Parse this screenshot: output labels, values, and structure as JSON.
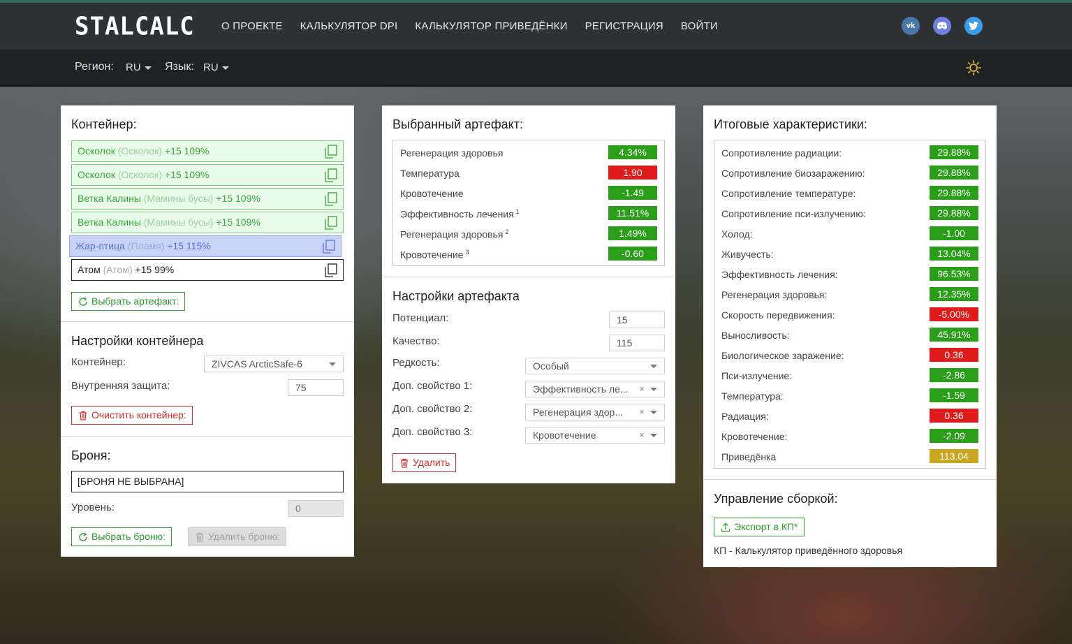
{
  "nav": {
    "logo": "STALCALC",
    "links": [
      "О ПРОЕКТЕ",
      "КАЛЬКУЛЯТОР DPI",
      "КАЛЬКУЛЯТОР ПРИВЕДЁНКИ",
      "РЕГИСТРАЦИЯ",
      "ВОЙТИ"
    ],
    "social": [
      "vk-icon",
      "discord-icon",
      "twitter-icon"
    ]
  },
  "subbar": {
    "region_label": "Регион:",
    "region_value": "RU",
    "lang_label": "Язык:",
    "lang_value": "RU"
  },
  "container_panel": {
    "title": "Контейнер:",
    "artifacts": [
      {
        "name": "Осколок",
        "sub": "(Осколок)",
        "level": "+15 109%"
      },
      {
        "name": "Осколок",
        "sub": "(Осколок)",
        "level": "+15 109%"
      },
      {
        "name": "Ветка Калины",
        "sub": "(Мамины бусы)",
        "level": "+15 109%"
      },
      {
        "name": "Ветка Калины",
        "sub": "(Мамины бусы)",
        "level": "+15 109%"
      },
      {
        "name": "Жар-птица",
        "sub": "(Пламя)",
        "level": "+15 115%"
      },
      {
        "name": "Атом",
        "sub": "(Атом)",
        "level": "+15 99%"
      }
    ],
    "select_button": "Выбрать артефакт:",
    "settings_title": "Настройки контейнера",
    "container_label": "Контейнер:",
    "container_value": "ZIVCAS ArcticSafe-6",
    "inner_protection_label": "Внутренняя защита:",
    "inner_protection_value": "75",
    "clear_button": "Очистить контейнер:",
    "armor_title": "Броня:",
    "armor_value": "[БРОНЯ НЕ ВЫБРАНА]",
    "level_label": "Уровень:",
    "level_value": "0",
    "select_armor_button": "Выбрать броню:",
    "delete_armor_button": "Удалить броню:"
  },
  "artifact_panel": {
    "title": "Выбранный артефакт:",
    "stats": [
      {
        "label": "Регенерация здоровья",
        "sup": "",
        "value": "4.34%",
        "color": "g"
      },
      {
        "label": "Температура",
        "sup": "",
        "value": "1.90",
        "color": "r"
      },
      {
        "label": "Кровотечение",
        "sup": "",
        "value": "-1.49",
        "color": "g"
      },
      {
        "label": "Эффективность лечения",
        "sup": "1",
        "value": "11.51%",
        "color": "g"
      },
      {
        "label": "Регенерация здоровья",
        "sup": "2",
        "value": "1.49%",
        "color": "g"
      },
      {
        "label": "Кровотечение",
        "sup": "3",
        "value": "-0.60",
        "color": "g"
      }
    ],
    "settings_title": "Настройки артефакта",
    "potential_label": "Потенциал:",
    "potential_value": "15",
    "quality_label": "Качество:",
    "quality_value": "115",
    "rarity_label": "Редкость:",
    "rarity_value": "Особый",
    "prop1_label": "Доп. свойство 1:",
    "prop1_value": "Эффективность ле...",
    "prop2_label": "Доп. свойство 2:",
    "prop2_value": "Регенерация здор...",
    "prop3_label": "Доп. свойство 3:",
    "prop3_value": "Кровотечение",
    "delete_button": "Удалить"
  },
  "result_panel": {
    "title": "Итоговые характеристики:",
    "stats": [
      {
        "label": "Сопротивление радиации:",
        "value": "29.88%",
        "color": "g"
      },
      {
        "label": "Сопротивление биозаражению:",
        "value": "29.88%",
        "color": "g"
      },
      {
        "label": "Сопротивление температуре:",
        "value": "29.88%",
        "color": "g"
      },
      {
        "label": "Сопротивление пси-излучению:",
        "value": "29.88%",
        "color": "g"
      },
      {
        "label": "Холод:",
        "value": "-1.00",
        "color": "g"
      },
      {
        "label": "Живучесть:",
        "value": "13.04%",
        "color": "g"
      },
      {
        "label": "Эффективность лечения:",
        "value": "96.53%",
        "color": "g"
      },
      {
        "label": "Регенерация здоровья:",
        "value": "12.35%",
        "color": "g"
      },
      {
        "label": "Скорость передвижения:",
        "value": "-5.00%",
        "color": "r"
      },
      {
        "label": "Выносливость:",
        "value": "45.91%",
        "color": "g"
      },
      {
        "label": "Биологическое заражение:",
        "value": "0.36",
        "color": "r"
      },
      {
        "label": "Пси-излучение:",
        "value": "-2.86",
        "color": "g"
      },
      {
        "label": "Температура:",
        "value": "-1.59",
        "color": "g"
      },
      {
        "label": "Радиация:",
        "value": "0.36",
        "color": "r"
      },
      {
        "label": "Кровотечение:",
        "value": "-2.09",
        "color": "g"
      },
      {
        "label": "Приведёнка",
        "value": "113.04",
        "color": "y"
      }
    ],
    "build_title": "Управление сборкой:",
    "export_button": "Экспорт в КП*",
    "footnote": "КП - Калькулятор приведённого здоровья"
  },
  "colors": {
    "green": "#2a9d19",
    "red": "#e01b1b",
    "yellow": "#c9a61f",
    "nav_bg": "#2f3234"
  }
}
